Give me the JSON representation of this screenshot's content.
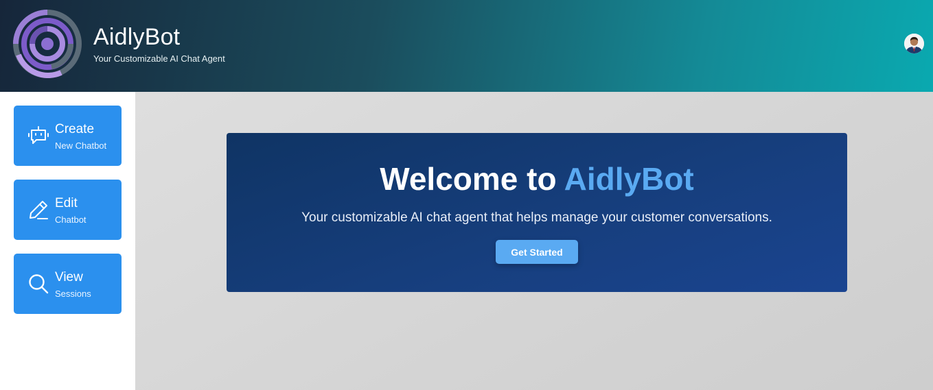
{
  "header": {
    "title": "AidlyBot",
    "subtitle": "Your Customizable AI Chat Agent",
    "logo_icon": "concentric-rings-logo",
    "avatar_icon": "user-avatar"
  },
  "sidebar": {
    "items": [
      {
        "title": "Create",
        "subtitle": "New Chatbot",
        "icon": "chatbot-icon"
      },
      {
        "title": "Edit",
        "subtitle": "Chatbot",
        "icon": "pencil-icon"
      },
      {
        "title": "View",
        "subtitle": "Sessions",
        "icon": "search-icon"
      }
    ]
  },
  "hero": {
    "title_prefix": "Welcome to ",
    "title_brand": "AidlyBot",
    "description": "Your customizable AI chat agent that helps manage your customer conversations.",
    "cta_label": "Get Started"
  },
  "colors": {
    "accent": "#2b90ee",
    "brand_highlight": "#5aaaf2",
    "hero_bg": "#173f7f"
  }
}
